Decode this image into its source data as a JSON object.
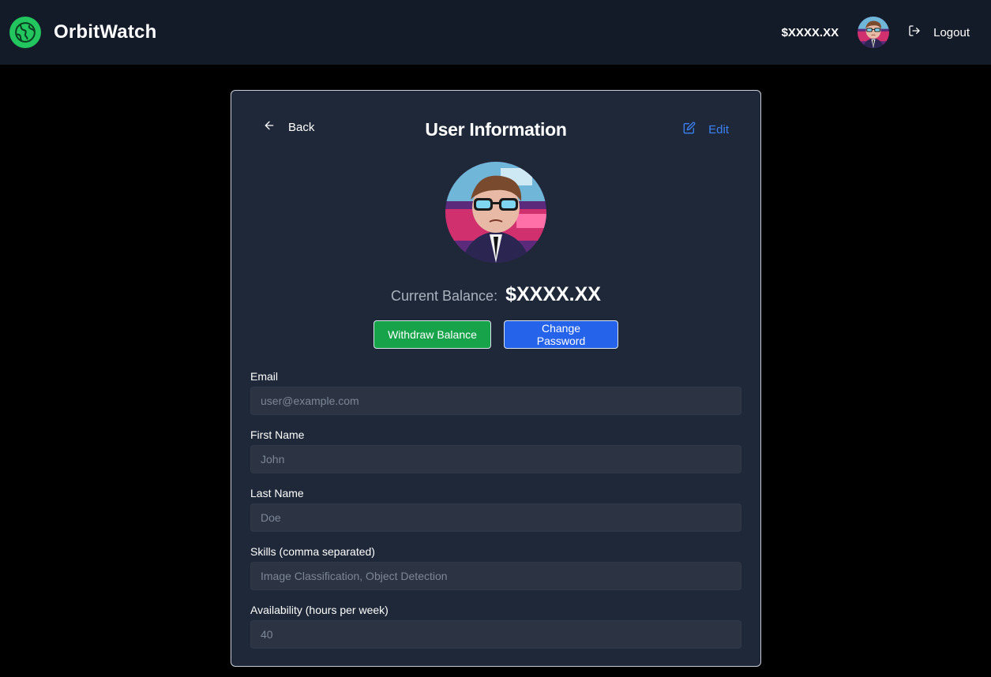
{
  "header": {
    "brand_name": "OrbitWatch",
    "balance": "$XXXX.XX",
    "logout_label": "Logout"
  },
  "card": {
    "back_label": "Back",
    "title": "User Information",
    "edit_label": "Edit",
    "balance_label": "Current Balance:",
    "balance_value": "$XXXX.XX",
    "withdraw_label": "Withdraw Balance",
    "change_password_label": "Change Password"
  },
  "form": {
    "email": {
      "label": "Email",
      "placeholder": "user@example.com",
      "value": ""
    },
    "first_name": {
      "label": "First Name",
      "placeholder": "John",
      "value": ""
    },
    "last_name": {
      "label": "Last Name",
      "placeholder": "Doe",
      "value": ""
    },
    "skills": {
      "label": "Skills (comma separated)",
      "placeholder": "Image Classification, Object Detection",
      "value": ""
    },
    "availability": {
      "label": "Availability (hours per week)",
      "placeholder": "40",
      "value": ""
    }
  },
  "icons": {
    "logo": "globe-icon",
    "logout": "logout-icon",
    "back": "arrow-left-icon",
    "edit": "edit-icon"
  },
  "colors": {
    "topbar_bg": "#131a28",
    "card_bg": "#1f2838",
    "input_bg": "#2c3444",
    "brand_green": "#22c55e",
    "withdraw_green": "#16a34a",
    "primary_blue": "#2563eb",
    "edit_blue": "#3b82f6"
  }
}
